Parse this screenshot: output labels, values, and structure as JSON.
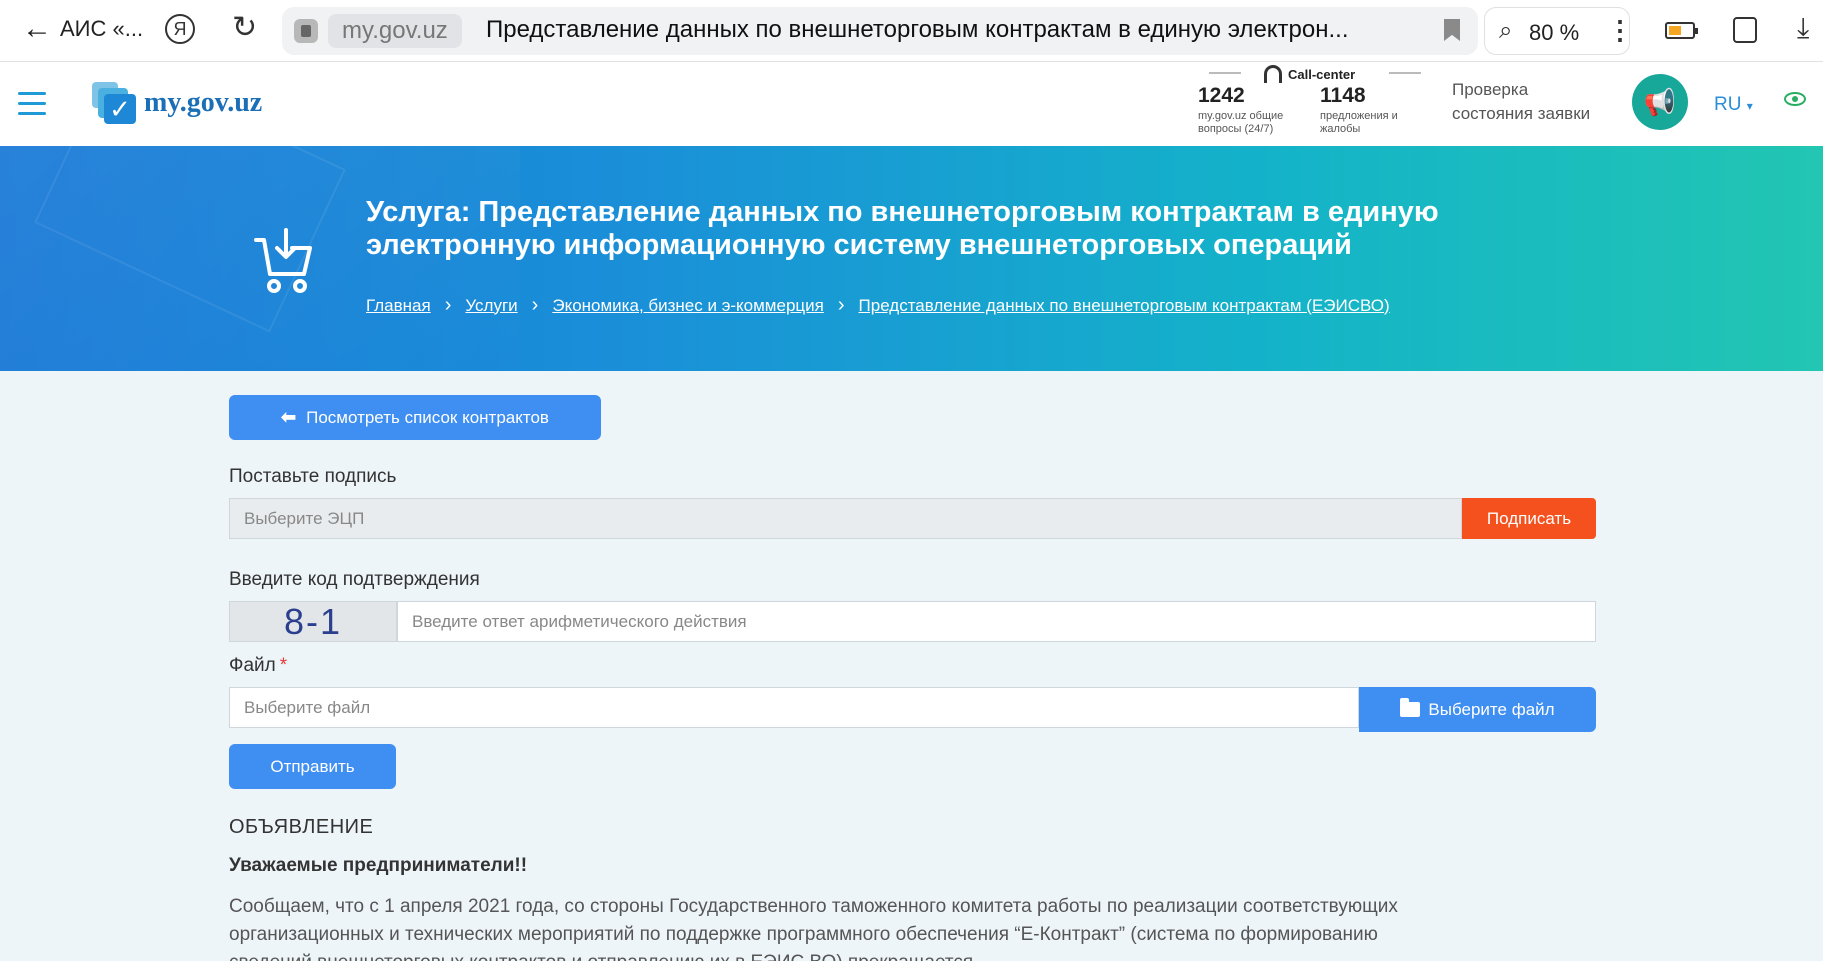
{
  "browser": {
    "back_label": "АИС «...",
    "yandex_label": "Я",
    "domain": "my.gov.uz",
    "page_title": "Представление данных по внешнеторговым контрактам в единую электрон...",
    "zoom": "80 %"
  },
  "header": {
    "logo_text": "my.gov.uz",
    "call_center_label": "Call-center",
    "stat1": {
      "number": "1242",
      "label_line1": "my.gov.uz общие",
      "label_line2": "вопросы (24/7)"
    },
    "stat2": {
      "number": "1148",
      "label_line1": "предложения и",
      "label_line2": "жалобы"
    },
    "status_check_line1": "Проверка",
    "status_check_line2": "состояния заявки",
    "language": "RU"
  },
  "banner": {
    "title_line1": "Услуга: Представление данных по внешнеторговым контрактам в единую",
    "title_line2": "электронную информационную систему внешнеторговых операций",
    "breadcrumbs": [
      "Главная",
      "Услуги",
      "Экономика, бизнес и э-коммерция",
      "Представление данных по внешнеторговым контрактам (ЕЭИСВО)"
    ]
  },
  "form": {
    "view_contracts_label": "Посмотреть список контрактов",
    "signature_label": "Поставьте подпись",
    "signature_placeholder": "Выберите ЭЦП",
    "sign_button": "Подписать",
    "code_label": "Введите код подтверждения",
    "captcha_text": "8-1",
    "captcha_placeholder": "Введите ответ арифметического действия",
    "file_label": "Файл",
    "required_mark": "*",
    "file_placeholder": "Выберите файл",
    "file_button": "Выберите файл",
    "submit_button": "Отправить"
  },
  "announcement": {
    "title": "ОБЪЯВЛЕНИЕ",
    "greeting": "Уважаемые предприниматели!!",
    "body_line1": "Сообщаем, что с 1 апреля 2021 года, со стороны Государственного таможенного комитета работы по реализации соответствующих",
    "body_line2": "организационных и технических мероприятий по поддержке программного обеспечения “Е-Контракт” (система по формированию",
    "body_line3": "сведений внешнеторговых контрактов и отправлению их в ЕЭИС ВО) прекращается."
  },
  "colors": {
    "primary_blue": "#3f8ef2",
    "sign_orange": "#f4511e",
    "banner_start": "#1677d6",
    "banner_end": "#22c6b2",
    "megaphone_teal": "#17a89a"
  },
  "icons": [
    "back-arrow-icon",
    "yandex-icon",
    "reload-icon",
    "lock-icon",
    "bookmark-icon",
    "search-zoom-icon",
    "kebab-menu-icon",
    "battery-icon",
    "copy-icon",
    "download-icon",
    "hamburger-icon",
    "headset-icon",
    "megaphone-icon",
    "chevron-down-icon",
    "eye-icon",
    "cart-icon",
    "arrow-left-icon",
    "folder-open-icon"
  ]
}
